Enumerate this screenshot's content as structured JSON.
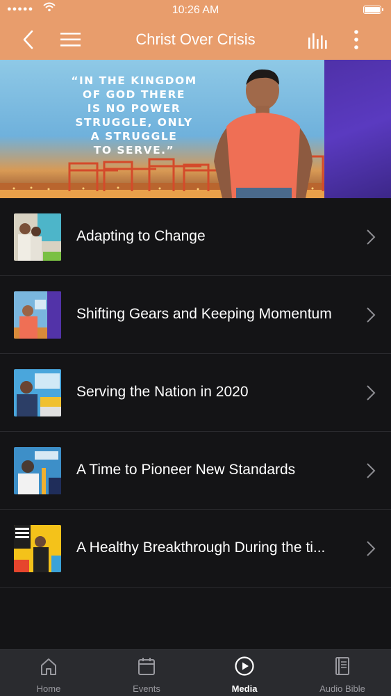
{
  "status_bar": {
    "time": "10:26 AM",
    "signal": "●●●●●"
  },
  "nav": {
    "title": "Christ Over Crisis"
  },
  "hero": {
    "quote": "“IN THE KINGDOM\nOF GOD THERE\nIS NO POWER\nSTRUGGLE, ONLY\nA STRUGGLE\nTO SERVE.”"
  },
  "media_list": {
    "items": [
      {
        "title": "Adapting to Change"
      },
      {
        "title": "Shifting Gears and Keeping Momentum"
      },
      {
        "title": "Serving the Nation in 2020"
      },
      {
        "title": "A Time to Pioneer New Standards"
      },
      {
        "title": "A Healthy Breakthrough During the ti..."
      }
    ]
  },
  "tab_bar": {
    "tabs": [
      {
        "label": "Home",
        "icon": "home-icon"
      },
      {
        "label": "Events",
        "icon": "calendar-icon"
      },
      {
        "label": "Media",
        "icon": "play-circle-icon",
        "active": true
      },
      {
        "label": "Audio Bible",
        "icon": "book-icon"
      }
    ]
  },
  "colors": {
    "header": "#e89d6c",
    "background": "#141416",
    "tab_bar": "#2a2b2f"
  }
}
